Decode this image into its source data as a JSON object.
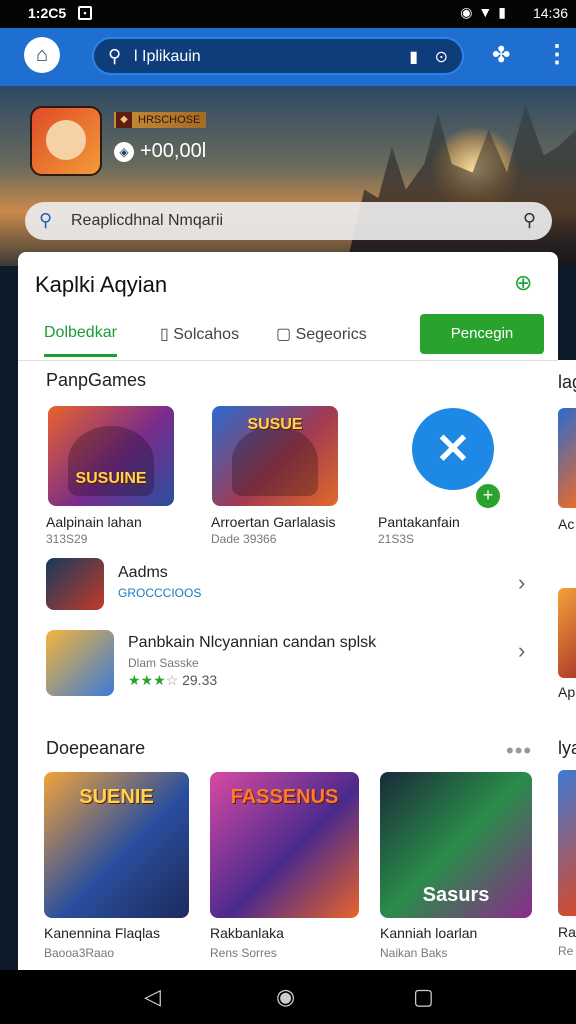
{
  "status_bar": {
    "time": "1:2C5",
    "right_time": "14:36"
  },
  "app_bar": {
    "search_text": "l Iplikauin"
  },
  "hero": {
    "badge_text": "HRSCHOSE",
    "coins": "+00,00l",
    "search_text": "Reaplicdhnal Nmqarii"
  },
  "card": {
    "title": "Kaplki Aqyian",
    "tabs": [
      {
        "label": "Dolbedkar"
      },
      {
        "label": "Solcahos"
      },
      {
        "label": "Segeorics"
      }
    ],
    "tab_button": "Pencegin",
    "section1": {
      "heading": "PanpGames",
      "tiles": [
        {
          "name": "Aalpinain lahan",
          "sub": "313S29",
          "wordmark": "SUSUINE"
        },
        {
          "name": "Arroertan Garlalasis",
          "sub": "Dade 39366",
          "wordmark": "SUSUE"
        },
        {
          "name": "Pantakanfain",
          "sub": "21S3S"
        }
      ]
    },
    "rows": [
      {
        "title": "Aadms",
        "sub": "GROCCCIOOS"
      },
      {
        "title": "Panbkain Nlcyannian  candan splsk",
        "sub": "Dlam Sasske",
        "rating": "29.33"
      }
    ],
    "section2": {
      "heading": "Doepeanare",
      "tiles": [
        {
          "name": "Kanennina Flaqlas",
          "sub": "Baooa3Raao",
          "wordmark": "SUENIE"
        },
        {
          "name": "Rakbanlaka",
          "sub": "Rens Sorres",
          "wordmark": "FASSENUS"
        },
        {
          "name": "Kanniah loarlan",
          "sub": "Naikan Baks",
          "wordmark": "Sasurs"
        }
      ]
    }
  },
  "peek": {
    "items": [
      "lag",
      "Ac",
      "Ap",
      "lya",
      "Ra",
      "Re"
    ]
  },
  "colors": {
    "accent_green": "#29a32d",
    "brand_blue": "#1e6fd0"
  }
}
